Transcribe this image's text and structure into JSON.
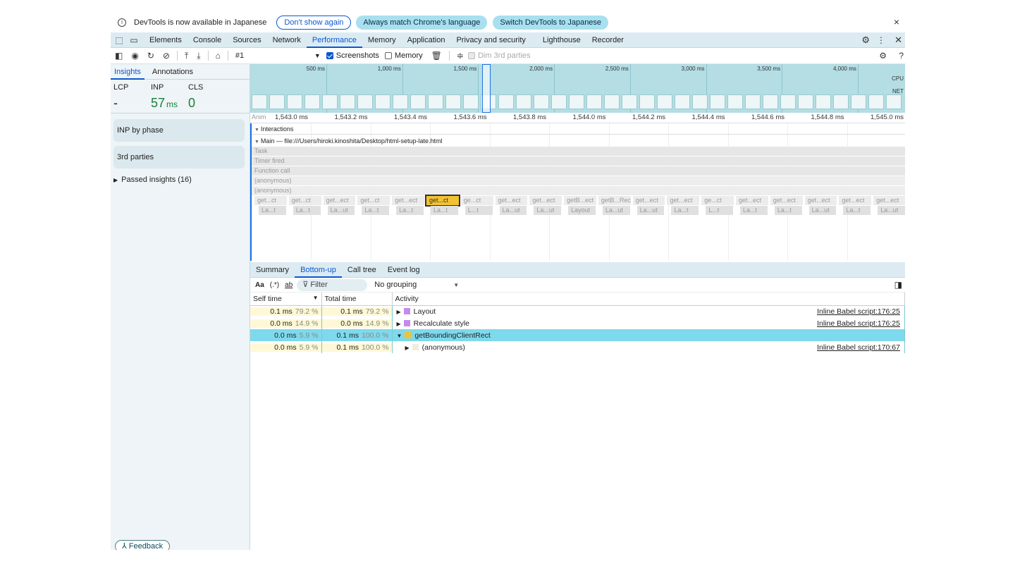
{
  "infobar": {
    "message": "DevTools is now available in Japanese",
    "dont_show": "Don't show again",
    "always_match": "Always match Chrome's language",
    "switch": "Switch DevTools to Japanese",
    "close": "×"
  },
  "tabs": [
    "Elements",
    "Console",
    "Sources",
    "Network",
    "Performance",
    "Memory",
    "Application",
    "Privacy and security",
    "Lighthouse",
    "Recorder"
  ],
  "toolbar": {
    "recording": "#1",
    "screenshots": "Screenshots",
    "memory": "Memory",
    "dim": "Dim 3rd parties"
  },
  "sidebar": {
    "tabs": [
      "Insights",
      "Annotations"
    ],
    "lcp_label": "LCP",
    "inp_label": "INP",
    "cls_label": "CLS",
    "lcp_value": "-",
    "inp_value": "57",
    "inp_unit": "ms",
    "cls_value": "0",
    "cards": [
      "INP by phase",
      "3rd parties"
    ],
    "passed": "Passed insights (16)",
    "feedback": "Feedback"
  },
  "overview": {
    "ticks": [
      "500 ms",
      "1,000 ms",
      "1,500 ms",
      "2,000 ms",
      "2,500 ms",
      "3,000 ms",
      "3,500 ms",
      "4,000 ms"
    ],
    "cpu": "CPU",
    "net": "NET"
  },
  "ruler": {
    "anim": "Anim",
    "ticks": [
      "1,543.0 ms",
      "1,543.2 ms",
      "1,543.4 ms",
      "1,543.6 ms",
      "1,543.8 ms",
      "1,544.0 ms",
      "1,544.2 ms",
      "1,544.4 ms",
      "1,544.6 ms",
      "1,544.8 ms",
      "1,545.0 ms"
    ]
  },
  "flame": {
    "interactions": "Interactions",
    "main": "Main — file:///Users/hiroki.kinoshita/Desktop/html-setup-late.html",
    "rows": [
      "Task",
      "Timer fired",
      "Function call",
      "(anonymous)",
      "(anonymous)"
    ],
    "calls": [
      "get...ct",
      "get...ct",
      "get...ect",
      "get...ct",
      "get...ect",
      "get...ct",
      "ge...ct",
      "get...ect",
      "get...ect",
      "getB...ect",
      "getB...Rect",
      "get...ect",
      "get...ect",
      "ge...ct",
      "get...ect",
      "get...ect",
      "get...ect",
      "get...ect",
      "get...ect"
    ],
    "layouts": [
      "La...t",
      "La...t",
      "La...ut",
      "La...t",
      "La...t",
      "La...t",
      "L...t",
      "La...ut",
      "La...ut",
      "Layout",
      "La...ut",
      "La...ut",
      "La...t",
      "L...t",
      "La...t",
      "La...t",
      "La...ut",
      "La...t",
      "La...ut"
    ]
  },
  "bottom": {
    "tabs": [
      "Summary",
      "Bottom-up",
      "Call tree",
      "Event log"
    ],
    "match_case": "Aa",
    "regex": "(.*)",
    "whole_word": "ab",
    "filter": "Filter",
    "grouping": "No grouping",
    "headers": [
      "Self time",
      "Total time",
      "Activity"
    ],
    "rows": [
      {
        "self": "0.1 ms",
        "self_pct": "79.2 %",
        "total": "0.1 ms",
        "total_pct": "79.2 %",
        "arrow": "▶",
        "name": "Layout",
        "color": "#c58af0",
        "link": "Inline Babel script:176:25"
      },
      {
        "self": "0.0 ms",
        "self_pct": "14.9 %",
        "total": "0.0 ms",
        "total_pct": "14.9 %",
        "arrow": "▶",
        "name": "Recalculate style",
        "color": "#c58af0",
        "link": "Inline Babel script:176:25"
      },
      {
        "self": "0.0 ms",
        "self_pct": "5.9 %",
        "total": "0.1 ms",
        "total_pct": "100.0 %",
        "arrow": "▼",
        "name": "getBoundingClientRect",
        "color": "#f2c233",
        "link": ""
      },
      {
        "self": "0.0 ms",
        "self_pct": "5.9 %",
        "total": "0.1 ms",
        "total_pct": "100.0 %",
        "arrow": "▶",
        "name": "(anonymous)",
        "color": "#f1eddc",
        "link": "Inline Babel script:170:67"
      }
    ]
  },
  "colors": {
    "accent": "#0b57d0",
    "selection": "#7fd9ec",
    "panel": "#dcebf2"
  }
}
